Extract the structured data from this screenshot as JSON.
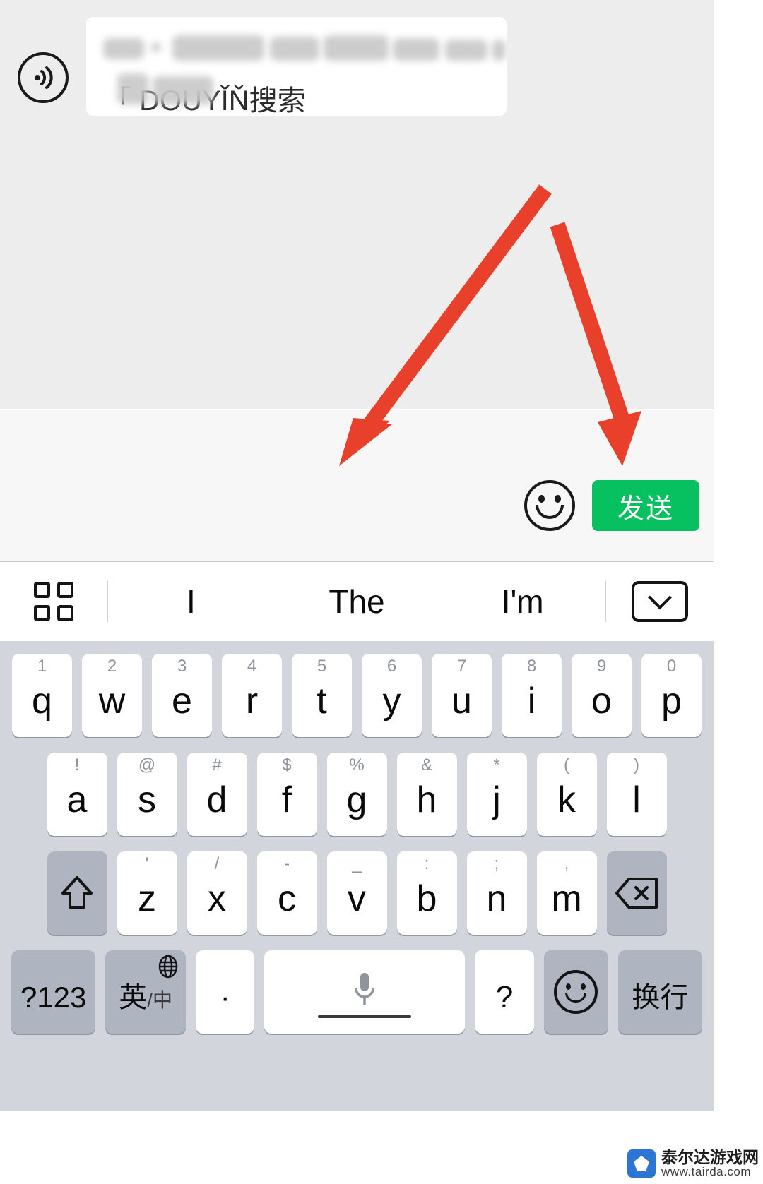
{
  "app": {
    "platform": "ios-chinese-keyboard",
    "accent_green": "#07C160",
    "keyboard_bg": "#D2D5DC",
    "fn_key_bg": "#AEB5C0",
    "chat_bg": "#EDEDED",
    "annotation_color": "#E8402A"
  },
  "chat": {
    "messages": []
  },
  "input_bar": {
    "voice_icon": "voice-wave-icon",
    "emoji_icon": "smiley-face-icon",
    "send_label": "发送",
    "input_value_line1": "",
    "input_value_line2": "「    DOUYǏŇ搜索",
    "input_placeholder": "",
    "redacted": true
  },
  "suggestion_bar": {
    "grid_icon": "grid-squares-icon",
    "items": [
      {
        "label": "I"
      },
      {
        "label": "The"
      },
      {
        "label": "I'm"
      }
    ],
    "collapse_icon": "chevron-down-box-icon"
  },
  "keyboard": {
    "rows": [
      {
        "id": "row1",
        "keys": [
          {
            "main": "q",
            "sub": "1"
          },
          {
            "main": "w",
            "sub": "2"
          },
          {
            "main": "e",
            "sub": "3"
          },
          {
            "main": "r",
            "sub": "4"
          },
          {
            "main": "t",
            "sub": "5"
          },
          {
            "main": "y",
            "sub": "6"
          },
          {
            "main": "u",
            "sub": "7"
          },
          {
            "main": "i",
            "sub": "8"
          },
          {
            "main": "o",
            "sub": "9"
          },
          {
            "main": "p",
            "sub": "0"
          }
        ]
      },
      {
        "id": "row2",
        "keys": [
          {
            "main": "a",
            "sub": "!"
          },
          {
            "main": "s",
            "sub": "@"
          },
          {
            "main": "d",
            "sub": "#"
          },
          {
            "main": "f",
            "sub": "$"
          },
          {
            "main": "g",
            "sub": "%"
          },
          {
            "main": "h",
            "sub": "&"
          },
          {
            "main": "j",
            "sub": "*"
          },
          {
            "main": "k",
            "sub": "("
          },
          {
            "main": "l",
            "sub": ")"
          }
        ]
      },
      {
        "id": "row3",
        "shift_icon": "shift-arrow-icon",
        "backspace_icon": "backspace-icon",
        "keys": [
          {
            "main": "z",
            "sub": "'"
          },
          {
            "main": "x",
            "sub": "/"
          },
          {
            "main": "c",
            "sub": "-"
          },
          {
            "main": "v",
            "sub": "_"
          },
          {
            "main": "b",
            "sub": ":"
          },
          {
            "main": "n",
            "sub": ";"
          },
          {
            "main": "m",
            "sub": ","
          }
        ]
      },
      {
        "id": "row4",
        "keys": [
          {
            "label": "?123",
            "name": "numeric-key"
          },
          {
            "label": "英",
            "label_secondary": "/中",
            "name": "language-key",
            "icon": "globe-icon"
          },
          {
            "label": "·",
            "name": "period-key"
          },
          {
            "label": "",
            "name": "space-key",
            "icon": "microphone-icon"
          },
          {
            "label": "?",
            "name": "question-key"
          },
          {
            "label": "",
            "name": "emoji-key",
            "icon": "smiley-icon"
          },
          {
            "label": "换行",
            "name": "newline-key"
          }
        ]
      }
    ]
  },
  "annotations": [
    {
      "name": "arrow-to-input-field",
      "color": "#E8402A"
    },
    {
      "name": "arrow-to-send-button",
      "color": "#E8402A"
    }
  ],
  "watermark": {
    "title": "泰尔达游戏网",
    "url": "www.tairda.com"
  }
}
